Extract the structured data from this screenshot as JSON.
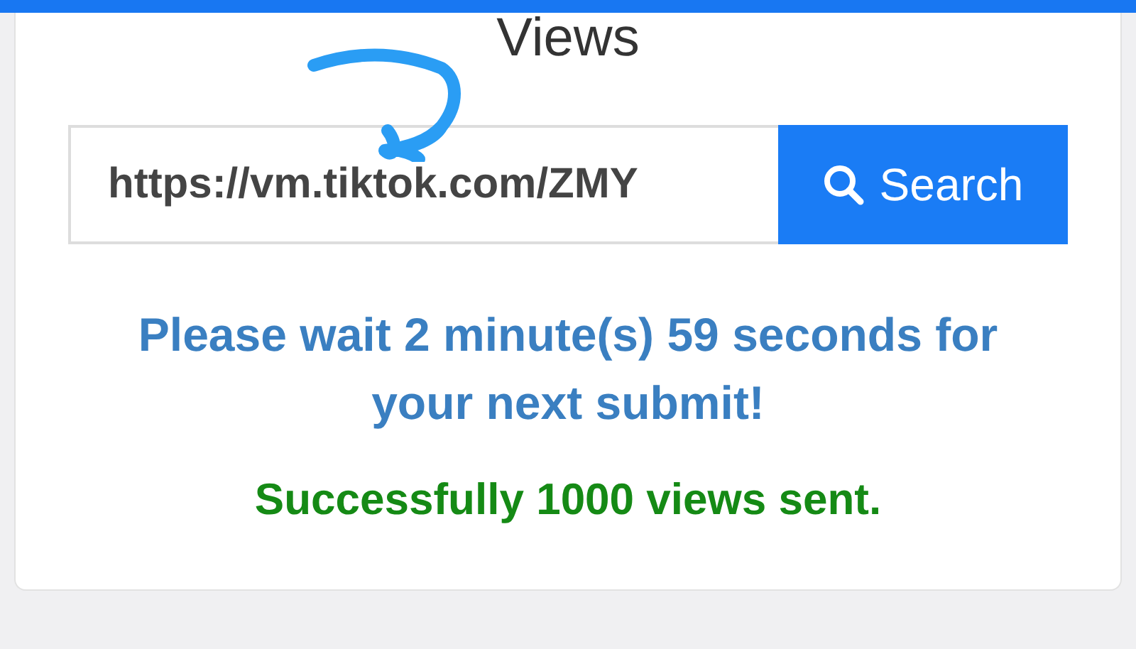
{
  "card": {
    "title": "Views"
  },
  "search": {
    "value": "https://vm.tiktok.com/ZMY",
    "button": "Search"
  },
  "wait_message": "Please wait 2 minute(s) 59 seconds for your next submit!",
  "success_message": "Successfully 1000 views sent."
}
